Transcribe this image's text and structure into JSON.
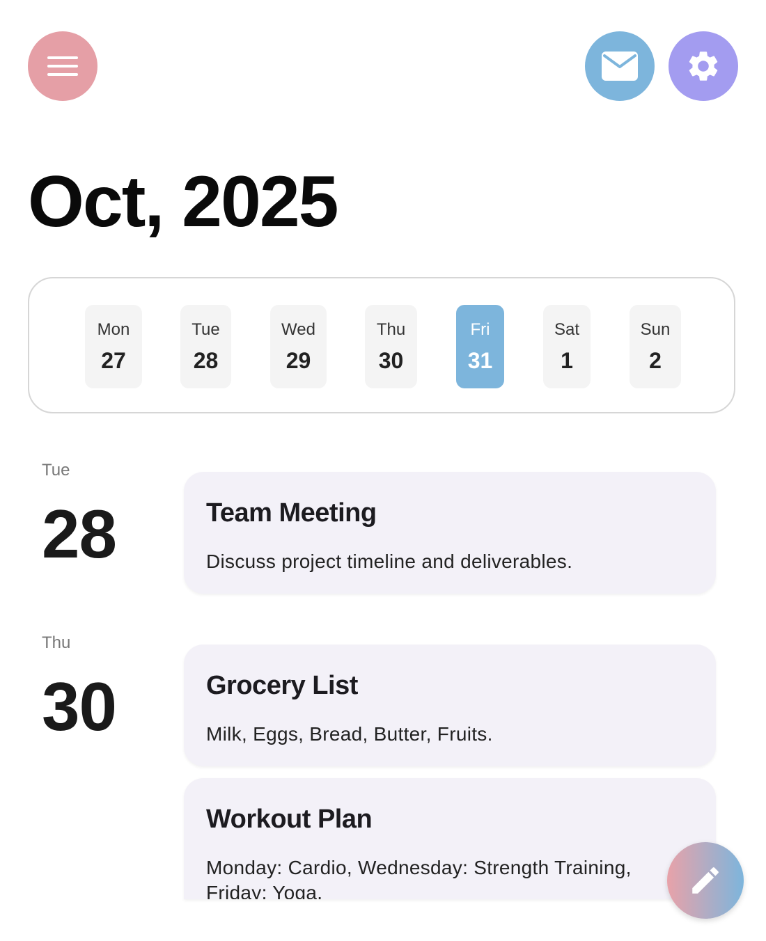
{
  "header": {
    "menu_icon": "hamburger-menu-icon",
    "mail_icon": "mail-icon",
    "settings_icon": "gear-icon",
    "colors": {
      "menu": "#e59fa6",
      "mail": "#7db5dc",
      "settings": "#a39cf0"
    }
  },
  "month_title": "Oct, 2025",
  "week": [
    {
      "name": "Mon",
      "num": "27",
      "selected": false
    },
    {
      "name": "Tue",
      "num": "28",
      "selected": false
    },
    {
      "name": "Wed",
      "num": "29",
      "selected": false
    },
    {
      "name": "Thu",
      "num": "30",
      "selected": false
    },
    {
      "name": "Fri",
      "num": "31",
      "selected": true
    },
    {
      "name": "Sat",
      "num": "1",
      "selected": false
    },
    {
      "name": "Sun",
      "num": "2",
      "selected": false
    }
  ],
  "groups": [
    {
      "weekday": "Tue",
      "day": "28"
    },
    {
      "weekday": "Thu",
      "day": "30"
    }
  ],
  "events": [
    {
      "title": "Team Meeting",
      "description": "Discuss project timeline and deliverables."
    },
    {
      "title": "Grocery List",
      "description": "Milk, Eggs, Bread, Butter, Fruits."
    },
    {
      "title": "Workout Plan",
      "description": "Monday: Cardio, Wednesday: Strength Training, Friday: Yoga."
    }
  ],
  "fab_icon": "pencil-icon",
  "accent_color": "#7db5dc"
}
